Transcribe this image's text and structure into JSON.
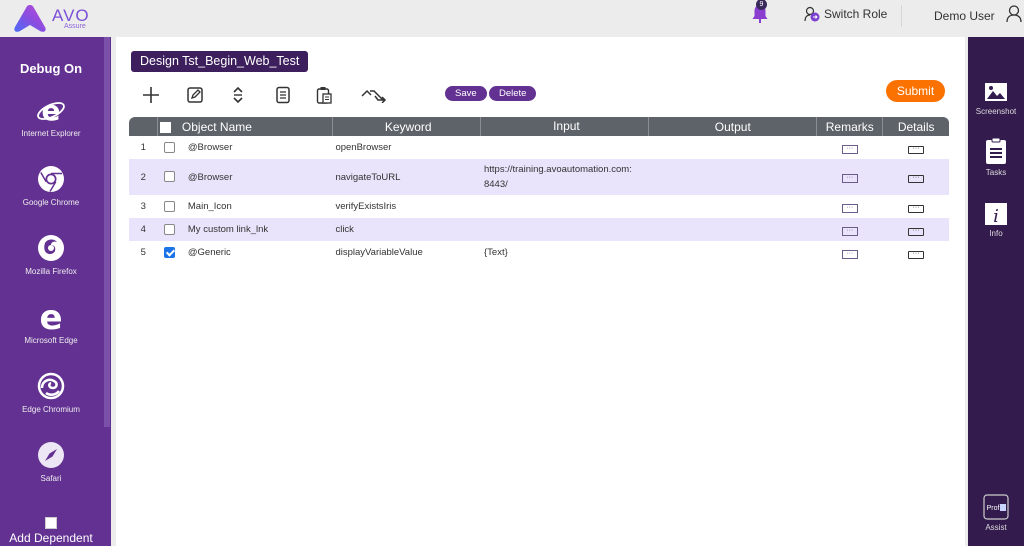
{
  "header": {
    "logo_text": "AVO",
    "logo_subtext": "Assure",
    "notification_count": "9",
    "switch_role_label": "Switch Role",
    "user_name": "Demo User"
  },
  "left_sidebar": {
    "title": "Debug On",
    "browsers": [
      {
        "label": "Internet Explorer",
        "icon": "internet-explorer-icon"
      },
      {
        "label": "Google Chrome",
        "icon": "google-chrome-icon"
      },
      {
        "label": "Mozilla Firefox",
        "icon": "mozilla-firefox-icon"
      },
      {
        "label": "Microsoft Edge",
        "icon": "microsoft-edge-icon"
      },
      {
        "label": "Edge Chromium",
        "icon": "edge-chromium-icon"
      },
      {
        "label": "Safari",
        "icon": "safari-icon"
      }
    ],
    "add_dependent_label": "Add Dependent",
    "add_dependent_checked": false
  },
  "main": {
    "design_title": "Design Tst_Begin_Web_Test",
    "toolbar": {
      "icons": [
        "add-step-icon",
        "edit-step-icon",
        "rearrange-icon",
        "copy-icon",
        "paste-icon",
        "skip-icon"
      ],
      "save_label": "Save",
      "delete_label": "Delete",
      "submit_label": "Submit"
    },
    "table": {
      "columns": [
        "Object Name",
        "Keyword",
        "Input",
        "Output",
        "Remarks",
        "Details"
      ],
      "rows": [
        {
          "num": "1",
          "checked": false,
          "object": "@Browser",
          "keyword": "openBrowser",
          "input": "",
          "output": ""
        },
        {
          "num": "2",
          "checked": false,
          "object": "@Browser",
          "keyword": "navigateToURL",
          "input": "https://training.avoautomation.com:",
          "input_line2": "8443/",
          "output": ""
        },
        {
          "num": "3",
          "checked": false,
          "object": "Main_Icon",
          "keyword": "verifyExistsIris",
          "input": "",
          "output": ""
        },
        {
          "num": "4",
          "checked": false,
          "object": "My custom link_lnk",
          "keyword": "click",
          "input": "",
          "output": ""
        },
        {
          "num": "5",
          "checked": true,
          "object": "@Generic",
          "keyword": "displayVariableValue",
          "input": "{Text}",
          "output": ""
        }
      ]
    }
  },
  "right_sidebar": {
    "items": [
      {
        "label": "Screenshot",
        "icon": "screenshot-icon"
      },
      {
        "label": "Tasks",
        "icon": "tasks-icon"
      },
      {
        "label": "Info",
        "icon": "info-icon"
      }
    ],
    "assist_label": "Assist",
    "assist_icon_text": "Prof"
  },
  "colors": {
    "primary_purple": "#633192",
    "dark_purple": "#341b4e",
    "title_bg": "#3c1f5c",
    "submit_orange": "#fb7200",
    "table_header": "#5e6369",
    "row_alt": "#e9e4fb"
  }
}
